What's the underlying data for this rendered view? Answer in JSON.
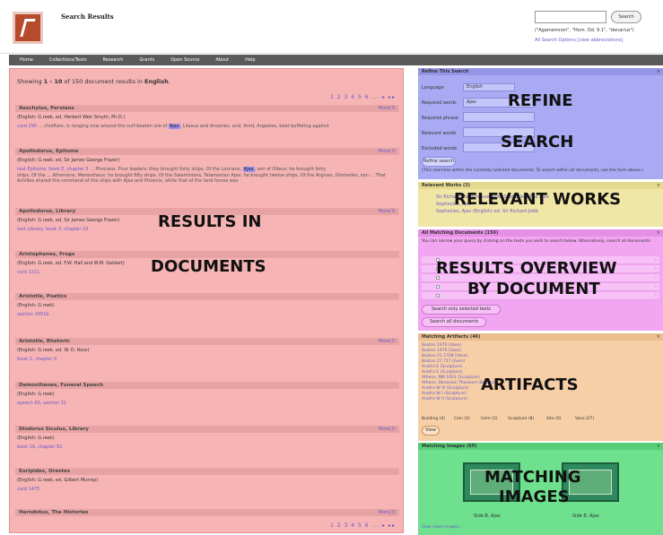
{
  "header": {
    "site_title": "Search Results",
    "search_button": "Search",
    "search_hint": "(\"Agamemnon\", \"Hom. Od. 9.1\", \"denarius\")",
    "search_options": "All Search Options [view abbreviations]"
  },
  "nav": [
    "Home",
    "Collections/Texts",
    "Research",
    "Grants",
    "Open Source",
    "About",
    "Help"
  ],
  "results": {
    "showing_prefix": "Showing ",
    "showing_range": "1 - 10",
    "showing_mid": " of 150 document results in ",
    "showing_lang": "English",
    "showing_suffix": ".",
    "pager": "1 2 3 4 5 6 ... ▸ ▸▸",
    "more_label": "More(3)",
    "items": [
      {
        "title": "Aeschylus, Persians",
        "trans": "(English: G.reek, ed. Herbert Weir Smyth, Ph.D.)",
        "line": "card 290",
        "snip_a": "... chieftain, is ranging now around the surf-beaten isle of ",
        "hl": "Ajax",
        "snip_b": ", Lilaeus and Arsames, and, third, Argestes, beat buffeting against",
        "snip_c": ""
      },
      {
        "title": "Apollodorus, Epitome",
        "trans": "(English: G.reek, ed. Sir James George Frazer)",
        "line": "text Epitome, book E, chapter 3",
        "snip_a": "... Phocians. Four leaders: they brought forty ships. Of the Locrians, ",
        "hl": "Ajax",
        "snip_b": ", son of Oileus: he brought forty",
        "snip_c": "ships. Of the ... Athenians, Menestheus: he brought fifty ships. Of the Salaminians, Telamonian Ajax: he brought twelve ships. Of the Argives, Diomedes, son ... That Achilles shared the command of the ships with Ajax and Phoenix, while that of the land forces was"
      },
      {
        "title": "Apollodorus, Library",
        "trans": "(English: G.reek, ed. Sir James George Frazer)",
        "line": "text Library, book 3, chapter 10",
        "snip_a": "",
        "hl": "",
        "snip_b": "",
        "snip_c": ""
      },
      {
        "title": "Aristophanes, Frogs",
        "trans": "(English: G.reek, ed. F.W. Hall and W.M. Geldart)",
        "line": "card 1211",
        "snip_a": "",
        "hl": "",
        "snip_b": "",
        "snip_c": ""
      },
      {
        "title": "Aristotle, Poetics",
        "trans": "(English: G.reek)",
        "line": "section 1451b",
        "snip_a": "",
        "hl": "",
        "snip_b": "",
        "snip_c": ""
      },
      {
        "title": "Aristotle, Rhetoric",
        "trans": "(English: G.reek, ed. W. D. Ross)",
        "line": "book 2, chapter 9",
        "snip_a": "",
        "hl": "",
        "snip_b": "",
        "snip_c": ""
      },
      {
        "title": "Demosthenes, Funeral Speech",
        "trans": "(English: G.reek)",
        "line": "speech 60, section 31",
        "snip_a": "",
        "hl": "",
        "snip_b": "",
        "snip_c": ""
      },
      {
        "title": "Diodorus Siculus, Library",
        "trans": "(English: G.reek)",
        "line": "book 16, chapter 82",
        "snip_a": "",
        "hl": "",
        "snip_b": "",
        "snip_c": ""
      },
      {
        "title": "Euripides, Orestes",
        "trans": "(English: G.reek, ed. Gilbert Murray)",
        "line": "card 1475",
        "snip_a": "",
        "hl": "",
        "snip_b": "",
        "snip_c": ""
      },
      {
        "title": "Herodotus, The Histories",
        "trans": "",
        "line": "",
        "snip_a": "",
        "hl": "",
        "snip_b": "",
        "snip_c": ""
      }
    ]
  },
  "overlays": {
    "results_a": "RESULTS IN",
    "results_b": "DOCUMENTS",
    "refine_a": "REFINE",
    "refine_b": "SEARCH",
    "works": "RELEVANT WORKS",
    "overview_a": "RESULTS OVERVIEW",
    "overview_b": "BY DOCUMENT",
    "artifacts": "ARTIFACTS",
    "images_a": "MATCHING",
    "images_b": "IMAGES"
  },
  "refine": {
    "title": "Refine This Search",
    "language_label": "Language",
    "language_value": "English",
    "required_words": "Required words",
    "required_words_value": "Ajax",
    "required_phrase": "Required phrase",
    "relevant_words": "Relevant words",
    "excluded_words": "Excluded words",
    "button": "Refine search",
    "note": "(This searches within the currently selected documents. To search within all documents, use the form above.)"
  },
  "works": {
    "title": "Relevant Works (3)",
    "items": [
      "Sir Richard Claverhouse Jebb, Sophocles: The Ajax",
      "Sophocles, Ajax",
      "Sophocles, Ajax (English) ed. Sir Richard Jebb"
    ]
  },
  "overview": {
    "title": "All Matching Documents (150)",
    "intro": "You can narrow your query by clicking on the texts you wish to search below. Alternatively, search all documents.",
    "btn_selected": "Search only selected texts",
    "btn_all": "Search all documents"
  },
  "artifacts": {
    "title": "Matching Artifacts (46)",
    "items": [
      "Boston 1970 (Vase)",
      "Boston 1970 (Vase)",
      "Boston 21.1708 (Vase)",
      "Boston 27.717 (Gem)",
      "Anafra E (Sculpture)",
      "Anafra E (Sculpture)",
      "Athens, NM 1001 (Sculpture)",
      "Athens, Dimosion Theseum (Building)",
      "Anafra W III (Sculpture)",
      "Anafra W I (Sculpture)",
      "Anafra W II (Sculpture)"
    ],
    "facets": [
      "Building (4)",
      "Coin (2)",
      "Gem (2)",
      "Sculpture (8)",
      "Site (0)",
      "Vase (27)"
    ],
    "view_btn": "View"
  },
  "images": {
    "title": "Matching Images (69)",
    "caption_1": "Side B. Ajax",
    "caption_2": "Side B. Ajax",
    "more": "View more images..."
  }
}
